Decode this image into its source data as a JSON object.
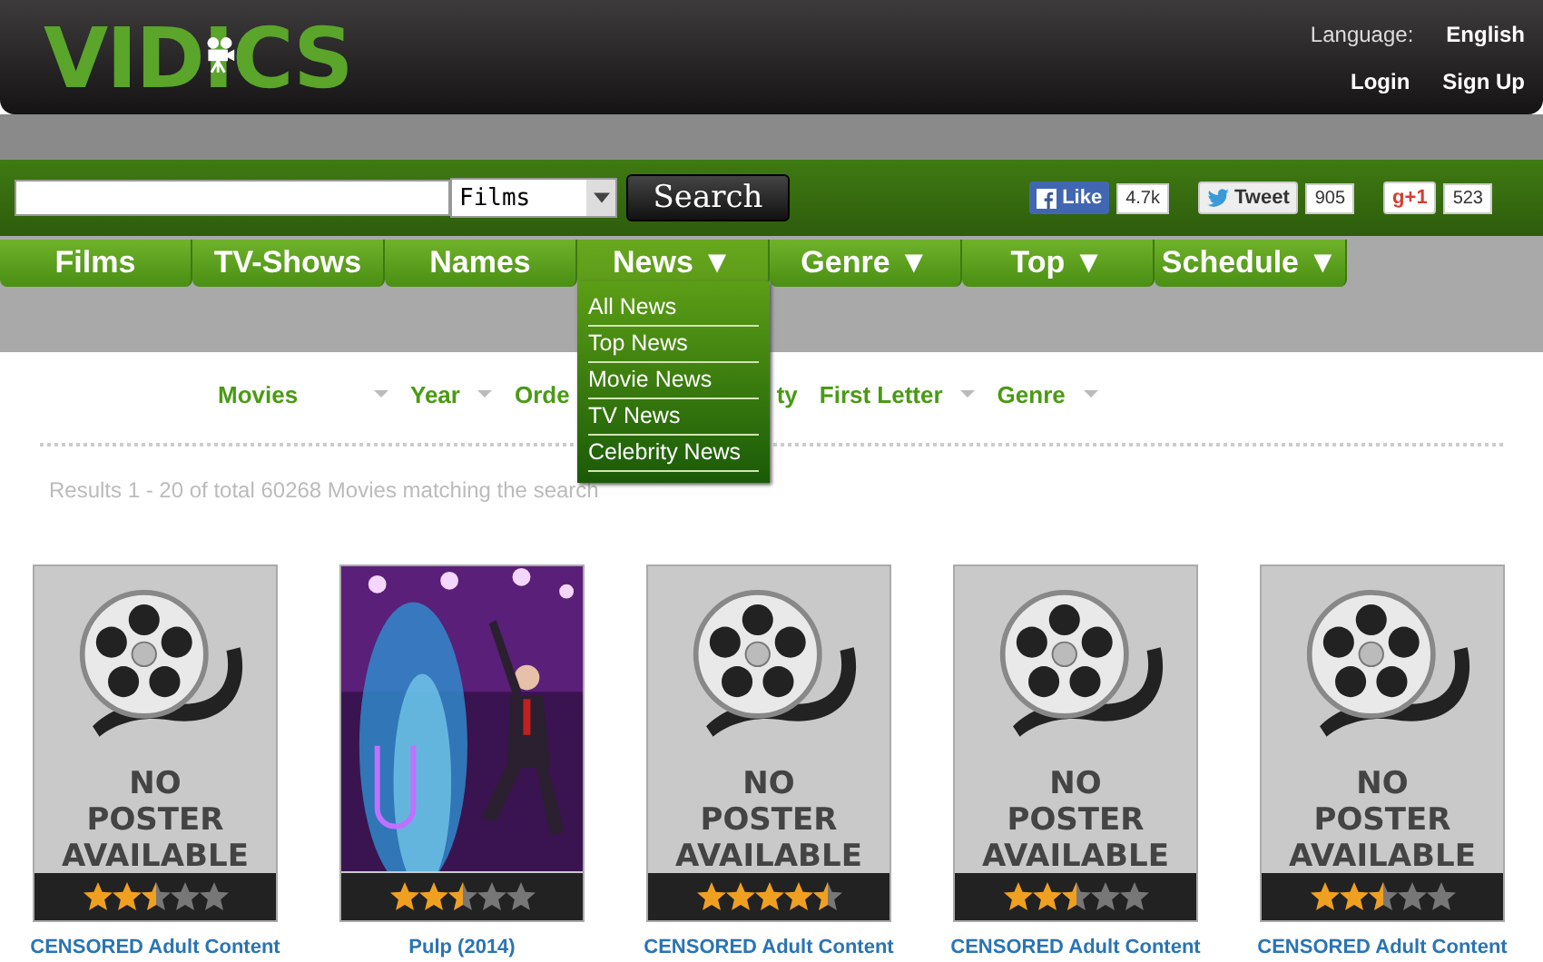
{
  "header": {
    "logo": "VIDICS",
    "language_label": "Language:",
    "language": "English",
    "links": [
      "Login",
      "Sign Up"
    ]
  },
  "search": {
    "category": "Films",
    "button": "Search"
  },
  "social": [
    {
      "kind": "facebook",
      "label": "Like",
      "count": "4.7k"
    },
    {
      "kind": "twitter",
      "label": "Tweet",
      "count": "905"
    },
    {
      "kind": "gplus",
      "label": "g+1",
      "count": "523"
    }
  ],
  "nav": [
    {
      "label": "Films",
      "selected": false
    },
    {
      "label": "TV-Shows",
      "selected": false
    },
    {
      "label": "Names",
      "selected": false
    },
    {
      "label": "News ▼",
      "selected": true
    },
    {
      "label": "Genre ▼",
      "selected": false
    },
    {
      "label": "Top ▼",
      "selected": false
    },
    {
      "label": "Schedule ▼",
      "selected": false
    }
  ],
  "news_menu": [
    "All News",
    "Top News",
    "Movie News",
    "TV News",
    "Celebrity News"
  ],
  "filters": [
    {
      "label": "Movies",
      "caret": true
    },
    {
      "label": "Year",
      "caret": true
    },
    {
      "label": "Orde",
      "caret": false
    },
    {
      "label": "ty",
      "caret": false
    },
    {
      "label": "First Letter",
      "caret": true
    },
    {
      "label": "Genre",
      "caret": true
    }
  ],
  "results": "Results 1 - 20 of total 60268 Movies matching the search",
  "movies": [
    {
      "kind": "no-poster",
      "poster_lines": [
        "NO",
        "POSTER",
        "AVAILABLE"
      ],
      "stars": 2.5,
      "title": "CENSORED Adult Content"
    },
    {
      "kind": "picture",
      "stars": 2.5,
      "title": "Pulp (2014)"
    },
    {
      "kind": "no-poster",
      "poster_lines": [
        "NO",
        "POSTER",
        "AVAILABLE"
      ],
      "stars": 4.5,
      "title": "CENSORED Adult Content"
    },
    {
      "kind": "no-poster",
      "poster_lines": [
        "NO",
        "POSTER",
        "AVAILABLE"
      ],
      "stars": 2.5,
      "title": "CENSORED Adult Content"
    },
    {
      "kind": "no-poster",
      "poster_lines": [
        "NO",
        "POSTER",
        "AVAILABLE"
      ],
      "stars": 2.5,
      "title": "CENSORED Adult Content"
    }
  ]
}
